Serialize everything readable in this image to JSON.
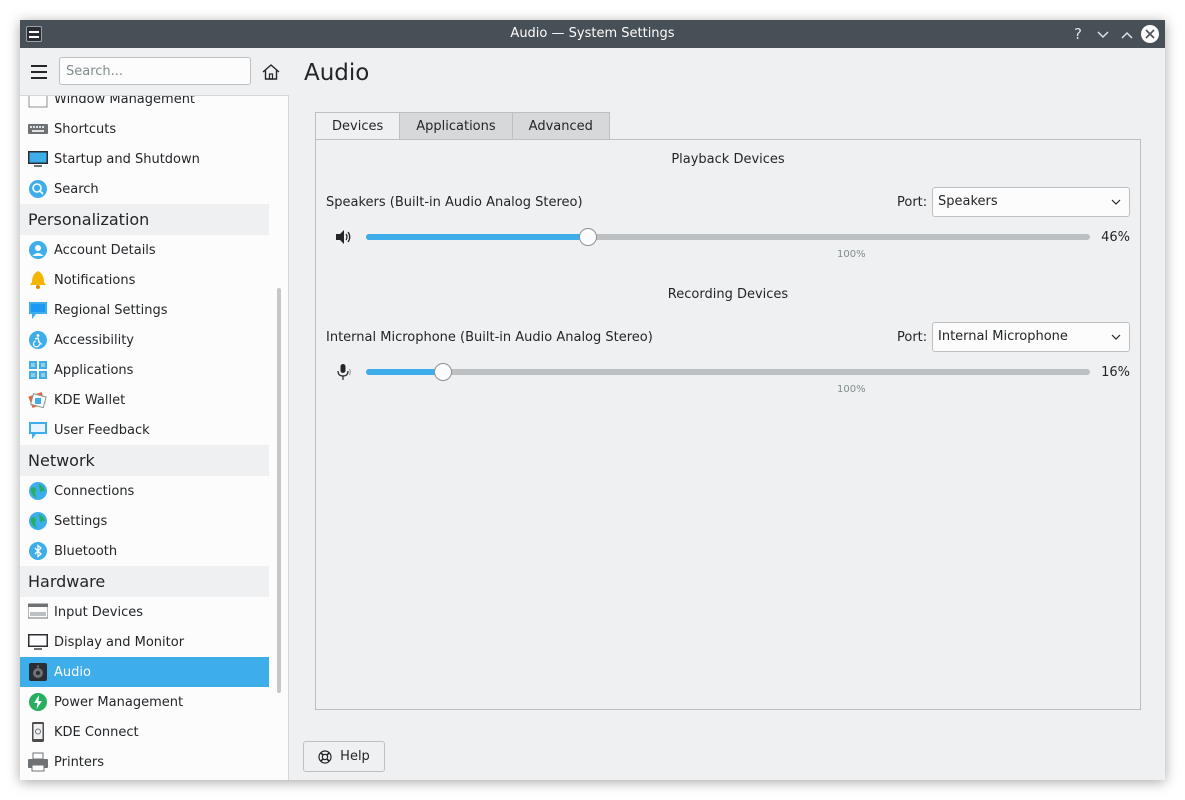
{
  "window": {
    "title": "Audio — System Settings",
    "help_glyph": "?",
    "minimize_glyph": "⌄",
    "maximize_glyph": "⌃",
    "close_glyph": "✕"
  },
  "sidebar": {
    "search_placeholder": "Search...",
    "items": [
      {
        "label": "Window Management",
        "icon": "window-icon"
      },
      {
        "label": "Shortcuts",
        "icon": "keyboard-icon"
      },
      {
        "label": "Startup and Shutdown",
        "icon": "monitor-icon"
      },
      {
        "label": "Search",
        "icon": "search-icon"
      }
    ],
    "personalization": {
      "heading": "Personalization",
      "items": [
        {
          "label": "Account Details",
          "icon": "user-icon"
        },
        {
          "label": "Notifications",
          "icon": "bell-icon"
        },
        {
          "label": "Regional Settings",
          "icon": "chat-flag-icon"
        },
        {
          "label": "Accessibility",
          "icon": "accessibility-icon"
        },
        {
          "label": "Applications",
          "icon": "grid-icon"
        },
        {
          "label": "KDE Wallet",
          "icon": "wallet-icon"
        },
        {
          "label": "User Feedback",
          "icon": "feedback-icon"
        }
      ]
    },
    "network": {
      "heading": "Network",
      "items": [
        {
          "label": "Connections",
          "icon": "globe-icon"
        },
        {
          "label": "Settings",
          "icon": "globe-icon"
        },
        {
          "label": "Bluetooth",
          "icon": "bluetooth-icon"
        }
      ]
    },
    "hardware": {
      "heading": "Hardware",
      "items": [
        {
          "label": "Input Devices",
          "icon": "input-devices-icon"
        },
        {
          "label": "Display and Monitor",
          "icon": "display-icon"
        },
        {
          "label": "Audio",
          "icon": "speaker-icon",
          "selected": true
        },
        {
          "label": "Power Management",
          "icon": "power-icon"
        },
        {
          "label": "KDE Connect",
          "icon": "phone-icon"
        },
        {
          "label": "Printers",
          "icon": "printer-icon"
        }
      ]
    }
  },
  "main": {
    "title": "Audio",
    "tabs": [
      {
        "label": "Devices",
        "active": true
      },
      {
        "label": "Applications",
        "active": false
      },
      {
        "label": "Advanced",
        "active": false
      }
    ],
    "playback": {
      "heading": "Playback Devices",
      "device_name": "Speakers (Built-in Audio Analog Stereo)",
      "port_label": "Port:",
      "port_value": "Speakers",
      "volume_percent": 46,
      "volume_text": "46%",
      "mark_label": "100%"
    },
    "recording": {
      "heading": "Recording Devices",
      "device_name": "Internal Microphone (Built-in Audio Analog Stereo)",
      "port_label": "Port:",
      "port_value": "Internal Microphone",
      "volume_percent": 16,
      "volume_text": "16%",
      "mark_label": "100%"
    },
    "help_label": "Help"
  },
  "colors": {
    "accent": "#3daee9",
    "titlebar": "#475057",
    "window_bg": "#eff0f1"
  }
}
